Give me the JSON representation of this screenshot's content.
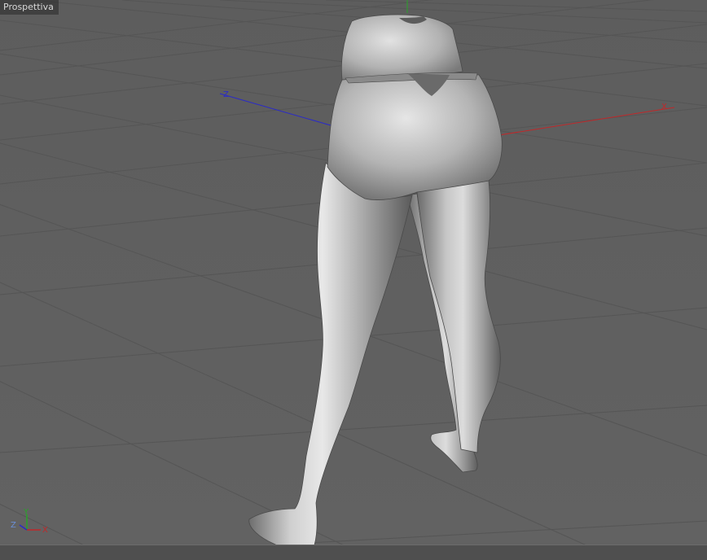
{
  "viewport": {
    "title": "Prospettiva",
    "axis_gizmo": {
      "y_label": "Y",
      "z_label": "Z",
      "x_label": "X"
    },
    "world_axes": {
      "x_color": "#c0282a",
      "y_color": "#29a329",
      "z_color": "#2a2ac8"
    },
    "object": "legs-mesh",
    "background_color": "#5f5f5f",
    "grid_color": "#545454"
  }
}
